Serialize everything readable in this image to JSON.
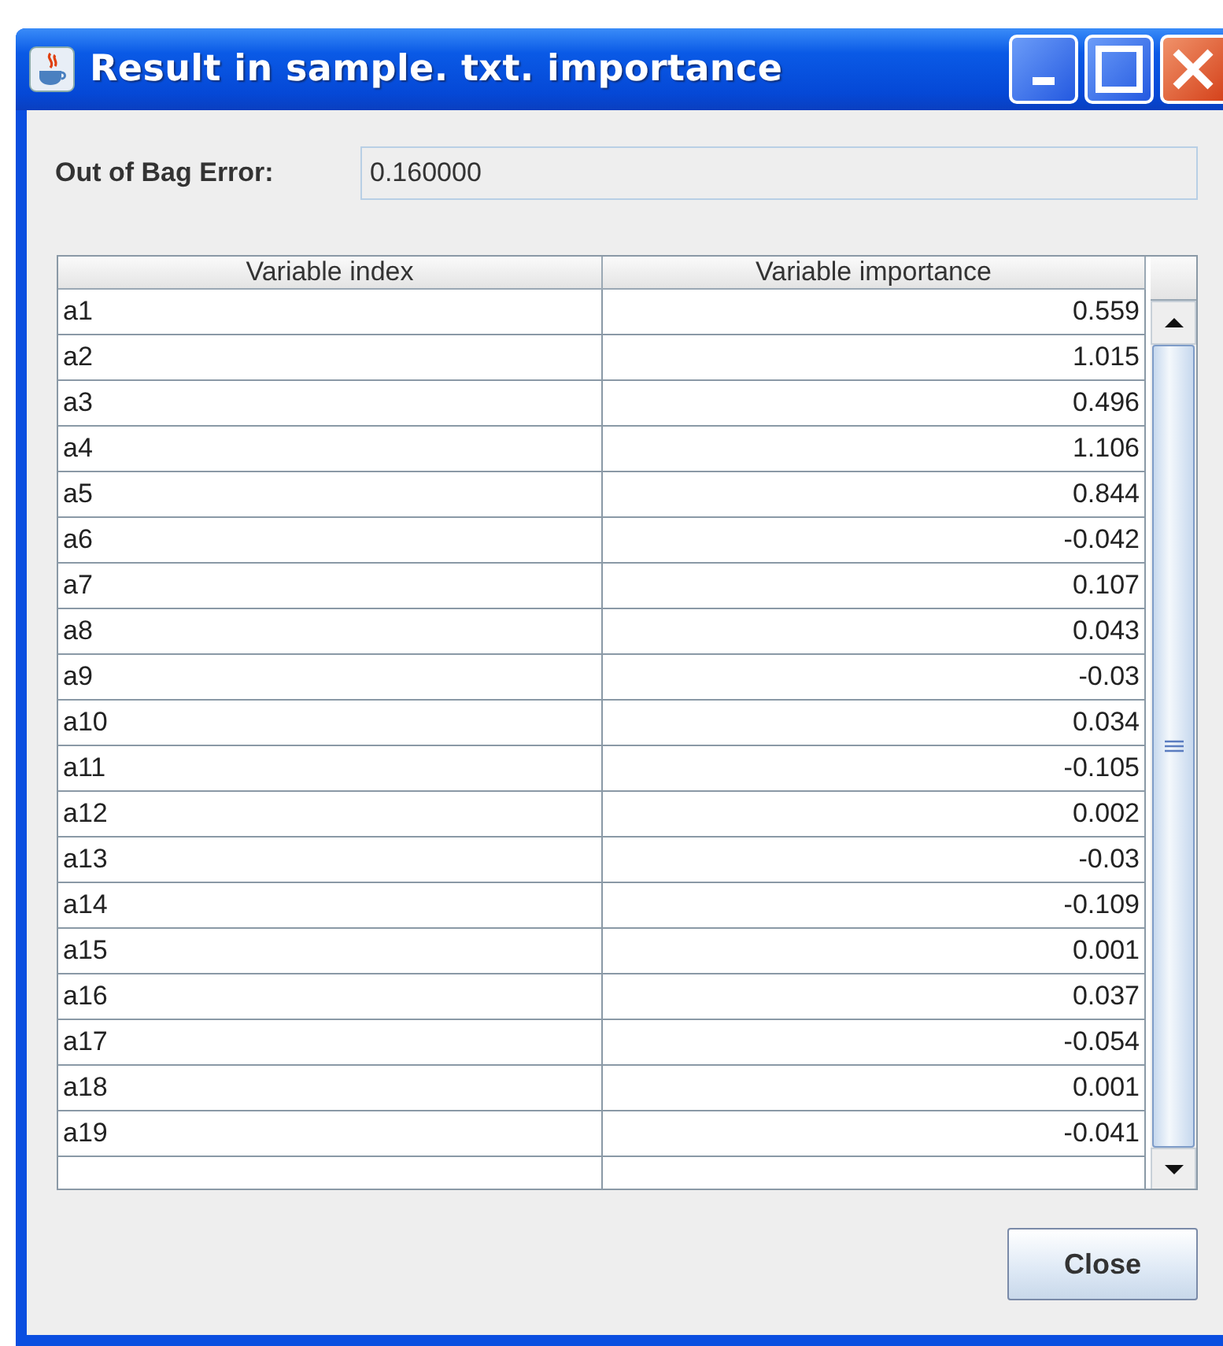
{
  "window": {
    "title": "Result in sample. txt. importance"
  },
  "oob": {
    "label": "Out of Bag Error:",
    "value": "0.160000"
  },
  "table": {
    "columns": [
      "Variable index",
      "Variable importance"
    ],
    "rows": [
      {
        "variable": "a1",
        "importance": "0.559"
      },
      {
        "variable": "a2",
        "importance": "1.015"
      },
      {
        "variable": "a3",
        "importance": "0.496"
      },
      {
        "variable": "a4",
        "importance": "1.106"
      },
      {
        "variable": "a5",
        "importance": "0.844"
      },
      {
        "variable": "a6",
        "importance": "-0.042"
      },
      {
        "variable": "a7",
        "importance": "0.107"
      },
      {
        "variable": "a8",
        "importance": "0.043"
      },
      {
        "variable": "a9",
        "importance": "-0.03"
      },
      {
        "variable": "a10",
        "importance": "0.034"
      },
      {
        "variable": "a11",
        "importance": "-0.105"
      },
      {
        "variable": "a12",
        "importance": "0.002"
      },
      {
        "variable": "a13",
        "importance": "-0.03"
      },
      {
        "variable": "a14",
        "importance": "-0.109"
      },
      {
        "variable": "a15",
        "importance": "0.001"
      },
      {
        "variable": "a16",
        "importance": "0.037"
      },
      {
        "variable": "a17",
        "importance": "-0.054"
      },
      {
        "variable": "a18",
        "importance": "0.001"
      },
      {
        "variable": "a19",
        "importance": "-0.041"
      }
    ]
  },
  "buttons": [
    "Close"
  ]
}
